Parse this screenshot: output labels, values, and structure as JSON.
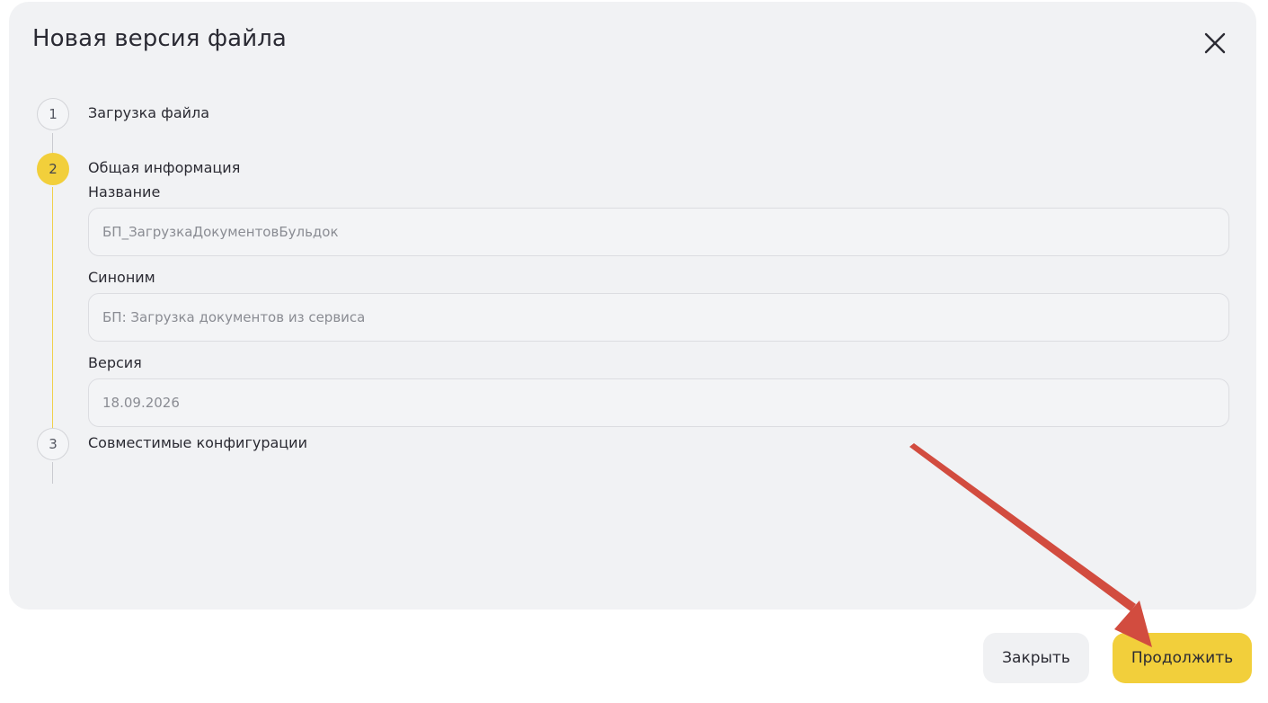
{
  "dialog": {
    "title": "Новая версия файла",
    "close_icon": "close-icon"
  },
  "steps": [
    {
      "number": "1",
      "label": "Загрузка файла",
      "state": "done"
    },
    {
      "number": "2",
      "label": "Общая информация",
      "state": "active"
    },
    {
      "number": "3",
      "label": "Совместимые конфигурации",
      "state": "pending"
    }
  ],
  "form": {
    "name": {
      "label": "Название",
      "value": "БП_ЗагрузкаДокументовБульдок"
    },
    "synonym": {
      "label": "Синоним",
      "value": "БП: Загрузка документов из сервиса"
    },
    "version": {
      "label": "Версия",
      "value": "18.09.2026"
    }
  },
  "footer": {
    "close_label": "Закрыть",
    "continue_label": "Продолжить"
  },
  "colors": {
    "accent": "#f2cf3b",
    "dialog_bg": "#f1f2f4",
    "annotation_arrow": "#d24c3f"
  },
  "annotation": {
    "icon": "annotation-arrow",
    "target": "continue-button"
  }
}
